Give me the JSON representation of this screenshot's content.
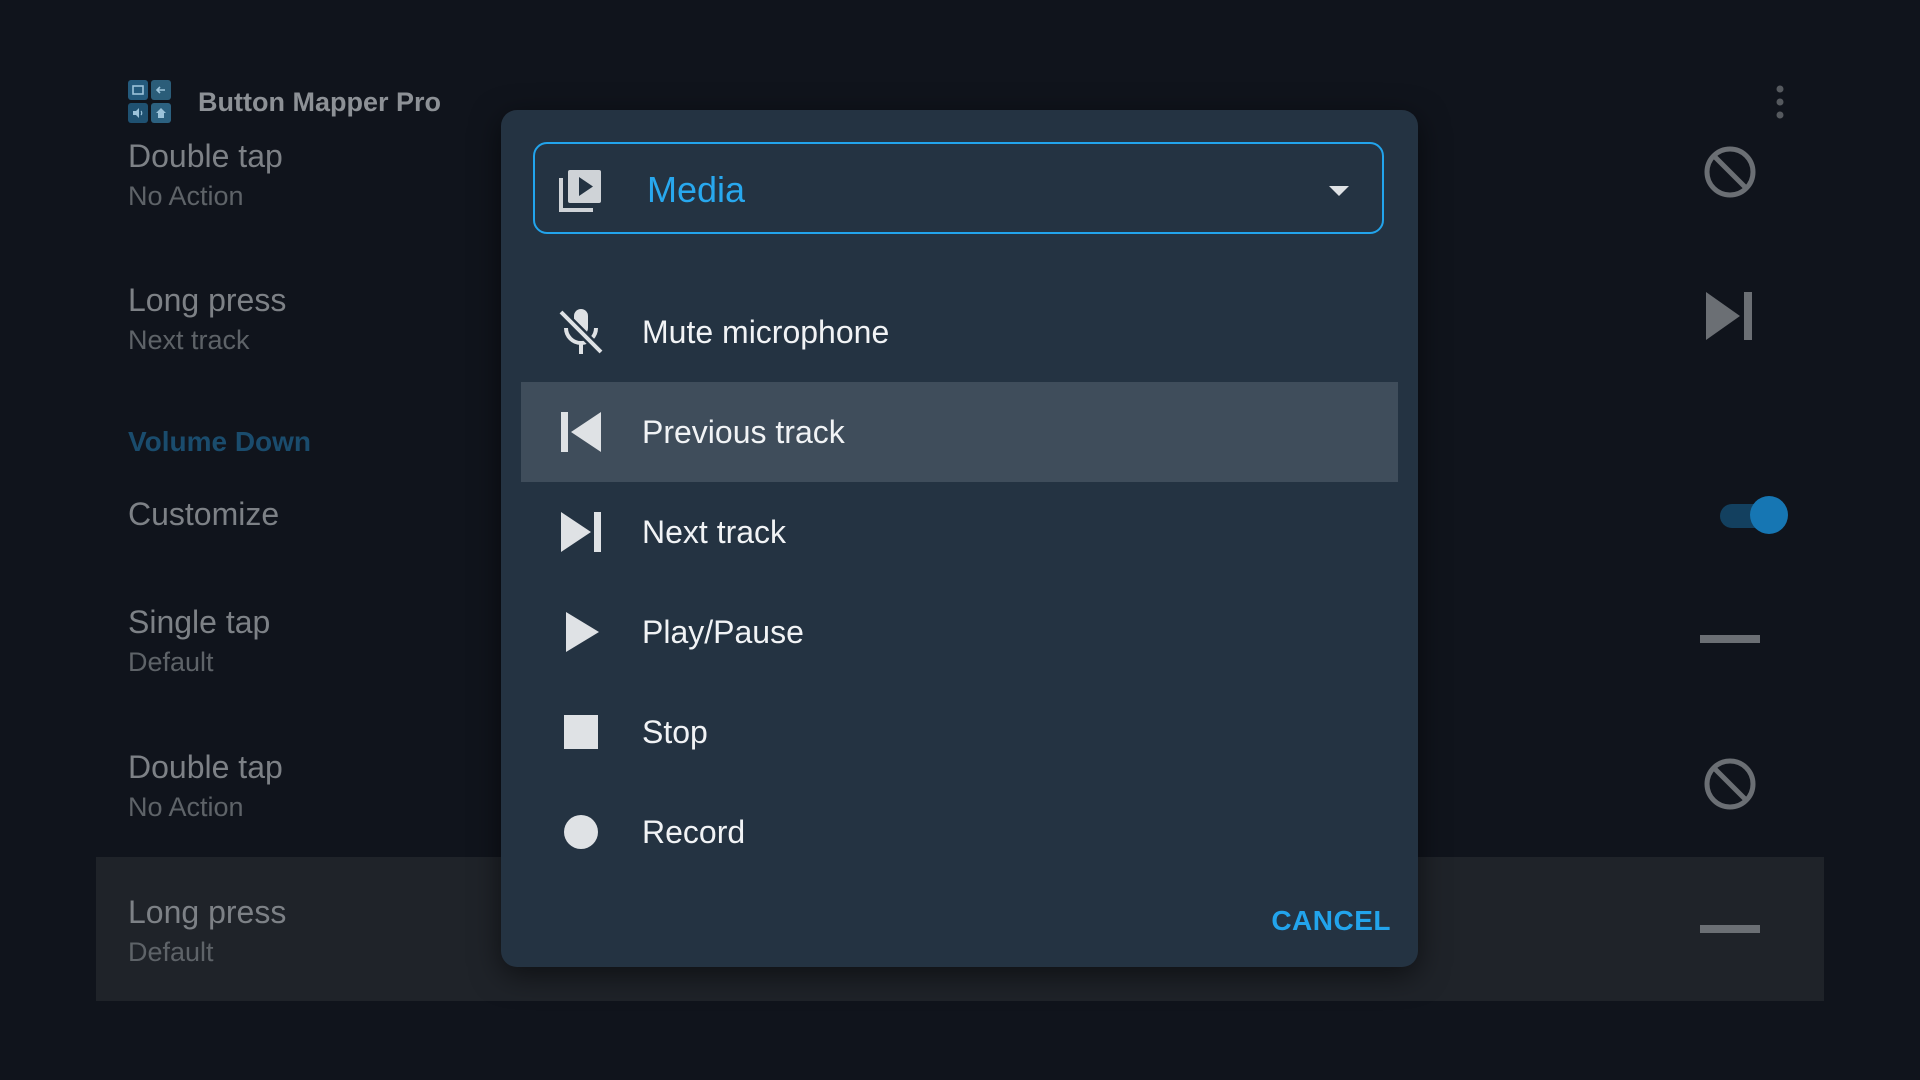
{
  "app": {
    "title": "Button Mapper Pro",
    "icon": "button-mapper-logo-icon",
    "menu_icon": "more-vertical-icon"
  },
  "background": {
    "rows": [
      {
        "title": "Double tap",
        "summary": "No Action",
        "icon": "block-icon"
      },
      {
        "title": "Long press",
        "summary": "Next track",
        "icon": "skip-next-icon"
      }
    ],
    "section_header": "Volume Down",
    "customize": {
      "label": "Customize",
      "toggle_on": true
    },
    "rows2": [
      {
        "title": "Single tap",
        "summary": "Default",
        "icon": "dash-icon"
      },
      {
        "title": "Double tap",
        "summary": "No Action",
        "icon": "block-icon"
      },
      {
        "title": "Long press",
        "summary": "Default",
        "icon": "dash-icon"
      }
    ]
  },
  "dialog": {
    "category": {
      "value": "Media",
      "icon": "media-library-icon",
      "arrow_icon": "dropdown-arrow-icon"
    },
    "options": [
      {
        "label": "Mute microphone",
        "icon": "mic-off-icon",
        "selected": false
      },
      {
        "label": "Previous track",
        "icon": "skip-previous-icon",
        "selected": true
      },
      {
        "label": "Next track",
        "icon": "skip-next-icon",
        "selected": false
      },
      {
        "label": "Play/Pause",
        "icon": "play-icon",
        "selected": false
      },
      {
        "label": "Stop",
        "icon": "stop-icon",
        "selected": false
      },
      {
        "label": "Record",
        "icon": "record-icon",
        "selected": false
      }
    ],
    "cancel_label": "CANCEL"
  },
  "colors": {
    "accent": "#22a4ec",
    "dialog_background": "#243342",
    "selected_row": "#3f4d5b",
    "screen_background": "#10141c"
  }
}
